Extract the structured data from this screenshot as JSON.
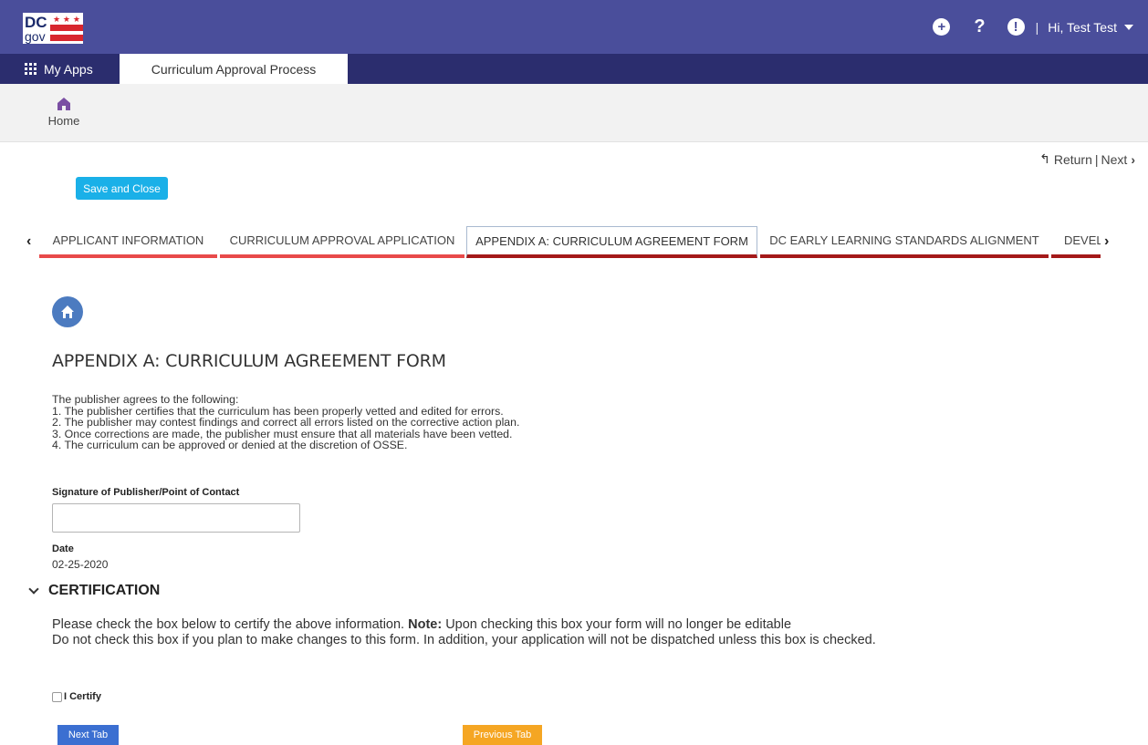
{
  "header": {
    "logo_text_top": "DC",
    "logo_text_bottom": "gov",
    "add_icon": "plus-circle-icon",
    "help_icon": "question-icon",
    "alert_icon": "exclamation-circle-icon",
    "separator": "|",
    "user_greeting": "Hi, Test Test",
    "colors": {
      "topbar": "#4a4e9b",
      "appbar": "#2b2d6e"
    }
  },
  "app_nav": {
    "my_apps_label": "My Apps",
    "current_app_tab": "Curriculum Approval Process"
  },
  "home_nav": {
    "home_label": "Home"
  },
  "page_nav": {
    "return_label": "Return",
    "separator": "|",
    "next_label": "Next"
  },
  "actions": {
    "save_close_label": "Save and Close"
  },
  "tabs": [
    {
      "label": "APPLICANT INFORMATION"
    },
    {
      "label": "CURRICULUM APPROVAL APPLICATION"
    },
    {
      "label": "APPENDIX A: CURRICULUM AGREEMENT FORM"
    },
    {
      "label": "DC EARLY LEARNING STANDARDS ALIGNMENT"
    },
    {
      "label": "DEVELOPMENTAL"
    }
  ],
  "form": {
    "title": "APPENDIX A: CURRICULUM AGREEMENT FORM",
    "agreement_lines": [
      "The publisher agrees to the following:",
      "1. The publisher certifies that the curriculum has been properly vetted and edited for errors.",
      "2. The publisher may contest findings and correct all errors listed on the corrective action plan.",
      "3. Once corrections are made, the publisher must ensure that all materials have been vetted.",
      "4. The curriculum can be approved or denied at the discretion of OSSE."
    ],
    "signature_label": "Signature of Publisher/Point of Contact",
    "signature_value": "",
    "date_label": "Date",
    "date_value": "02-25-2020"
  },
  "certification": {
    "heading": "CERTIFICATION",
    "text_intro": "Please check the box below to certify the above information. ",
    "text_note_label": "Note:",
    "text_note": " Upon checking this box your form will no longer be editable",
    "text_line2": "Do not check this box if you plan to make changes to this form. In addition, your application will not be dispatched unless this box is checked.",
    "checkbox_label": "I Certify",
    "checked": false
  },
  "footer_buttons": {
    "next_tab_label": "Next Tab",
    "previous_tab_label": "Previous Tab"
  }
}
